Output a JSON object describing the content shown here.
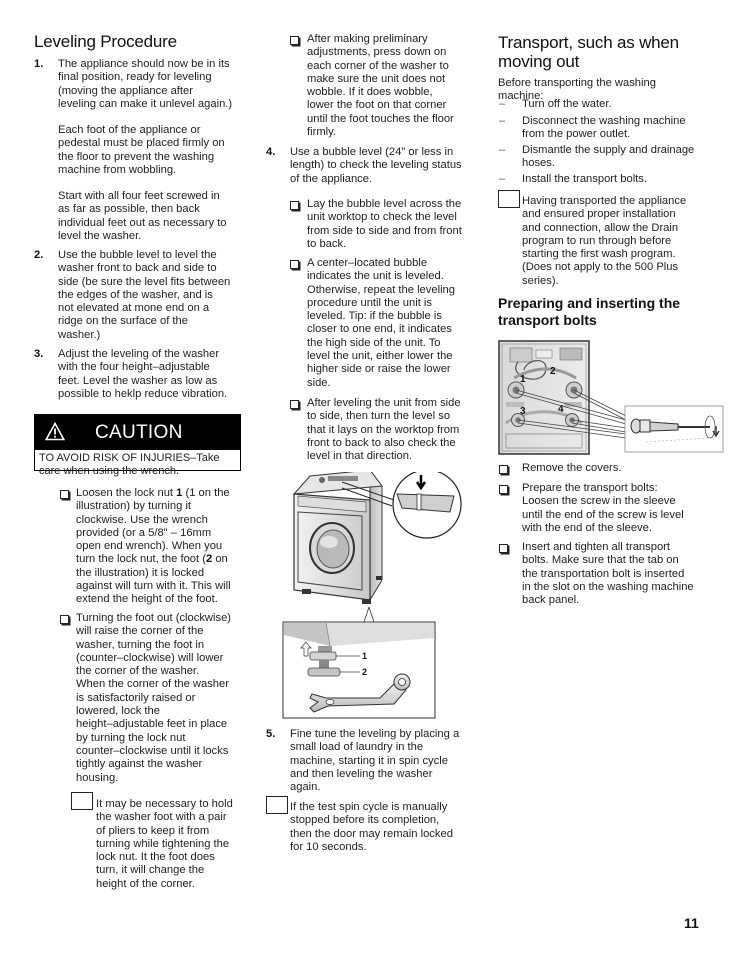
{
  "page_number": "11",
  "leveling": {
    "title": "Leveling Procedure",
    "step1": {
      "num": "1.",
      "p1": [
        "The appliance should now be in its",
        "final position, ready for leveling",
        "(moving the appliance after",
        "leveling can make it unlevel again.)"
      ],
      "p2": [
        "Each foot of the appliance or",
        "pedestal must be placed firmly on",
        "the floor to prevent the washing",
        "machine from wobbling."
      ],
      "p3": [
        "Start with all four feet screwed in",
        "as far as possible, then back",
        "individual feet out as necessary to",
        "level the washer."
      ]
    },
    "step2": {
      "num": "2.",
      "lines": [
        "Use the bubble level to level the",
        "washer front to back and side to",
        "side (be sure the level fits between",
        "the edges of the washer, and is",
        "not elevated at mone end on a",
        "ridge on the surface of the",
        "washer.)"
      ]
    },
    "step3": {
      "num": "3.",
      "lines": [
        "Adjust the leveling of the washer",
        "with the four height–adjustable",
        "feet.  Level the washer as low as",
        "possible to heklp reduce vibration."
      ]
    },
    "caution": {
      "icon": "warning-triangle-icon",
      "label": "CAUTION",
      "message_lines": [
        "TO AVOID RISK OF INJURIES–Take",
        "care when using the wrench."
      ]
    },
    "bullet_loosen": {
      "l1_pre": "Loosen the lock nut ",
      "l1_bold": "1",
      "l1_post": " (1 on the",
      "lines_mid": [
        "illustration) by turning it",
        "clockwise.  Use the wrench",
        "provided (or a 5/8\" – 16mm",
        "open end wrench).  When you"
      ],
      "l6_pre": "turn the lock nut, the foot (",
      "l6_bold": "2",
      "l6_post": " on",
      "lines_end": [
        "the illustration) it is locked",
        "against will turn with it.  This will",
        "extend the height of the foot."
      ]
    },
    "bullet_turning": {
      "lines": [
        "Turning the foot out (clockwise)",
        "will raise the corner of the",
        "washer, turning the foot in",
        "(counter–clockwise) will lower",
        "the corner of the washer.",
        "When the corner of the washer",
        "is satisfactorily raised or",
        "lowered, lock the",
        "height–adjustable feet in place",
        "by turning the lock nut",
        "counter–clockwise until it locks",
        "tightly against the washer",
        "housing."
      ]
    },
    "note_pliers": {
      "lines": [
        "It may be necessary to hold",
        "the washer foot with a pair",
        "of pliers to keep it from",
        "turning while tightening the",
        "lock nut.  It the foot does",
        "turn, it will change the",
        "height of the corner."
      ]
    }
  },
  "column2": {
    "bullet_after": {
      "lines": [
        "After making preliminary",
        "adjustments, press down on",
        "each corner of the washer to",
        "make sure the unit does not",
        "wobble.  If it does wobble,",
        "lower the foot on that corner",
        "until the foot touches the floor",
        "firmly."
      ]
    },
    "step4": {
      "num": "4.",
      "lines": [
        "Use a bubble level (24\" or less in",
        "length) to check the leveling status",
        "of the appliance."
      ]
    },
    "bullet_lay": {
      "lines": [
        "Lay the bubble level across the",
        "unit worktop to check the level",
        "from side to side and from front",
        "to back."
      ]
    },
    "bullet_center": {
      "lines": [
        "A center–located bubble",
        "indicates the unit is leveled.",
        "Otherwise, repeat the leveling",
        "procedure until the unit is",
        "leveled.  Tip: if the bubble is",
        "closer to one end, it indicates",
        "the high side of the unit.  To",
        "level the unit, either lower the",
        "higher side or raise the lower",
        "side."
      ]
    },
    "bullet_afterlevel": {
      "lines": [
        "After leveling the unit from side",
        "to side, then turn the level so",
        "that it lays on the worktop from",
        "front to back to also check the",
        "level in that direction."
      ]
    },
    "figure": {
      "description": "washer-with-bubble-level-and-foot-wrench-illustration",
      "labels": [
        "1",
        "2"
      ]
    },
    "step5": {
      "num": "5.",
      "lines": [
        "Fine tune the leveling by placing a",
        "small load of laundry in the",
        "machine, starting it in spin cycle",
        "and then leveling the washer",
        "again."
      ]
    },
    "note_spin": {
      "lines": [
        "If the test spin cycle is manually",
        "stopped before its completion,",
        "then the door may remain locked",
        "for 10 seconds."
      ]
    }
  },
  "transport": {
    "title_lines": [
      "Transport, such as when",
      "moving out"
    ],
    "intro_lines": [
      "Before transporting the washing",
      "machine:"
    ],
    "dash_items": [
      [
        "Turn off the water."
      ],
      [
        "Disconnect the washing machine",
        "from the power outlet."
      ],
      [
        "Dismantle the supply and drainage",
        "hoses."
      ],
      [
        "Install the transport bolts."
      ]
    ],
    "dash_glyph": "–",
    "note_drain": {
      "lines": [
        "Having transported the appliance",
        "and ensured proper installation",
        "and connection, allow the Drain",
        "program to run through before",
        "starting the first wash program.",
        "(Does not apply to the 500 Plus",
        "series)."
      ]
    },
    "subtitle_lines": [
      "Preparing and inserting the",
      "transport bolts"
    ],
    "figure": {
      "description": "washer-back-panel-transport-bolt-positions",
      "labels": [
        "1",
        "2",
        "3",
        "4"
      ]
    },
    "bullets": [
      [
        "Remove the covers."
      ],
      [
        "Prepare the transport bolts:",
        "Loosen the screw in the sleeve",
        "until the end of the screw is level",
        "with the end of the sleeve."
      ],
      [
        "Insert and tighten all transport",
        "bolts. Make sure that the tab on",
        "the transportation bolt is inserted",
        "in the slot on the washing machine",
        "back panel."
      ]
    ]
  }
}
